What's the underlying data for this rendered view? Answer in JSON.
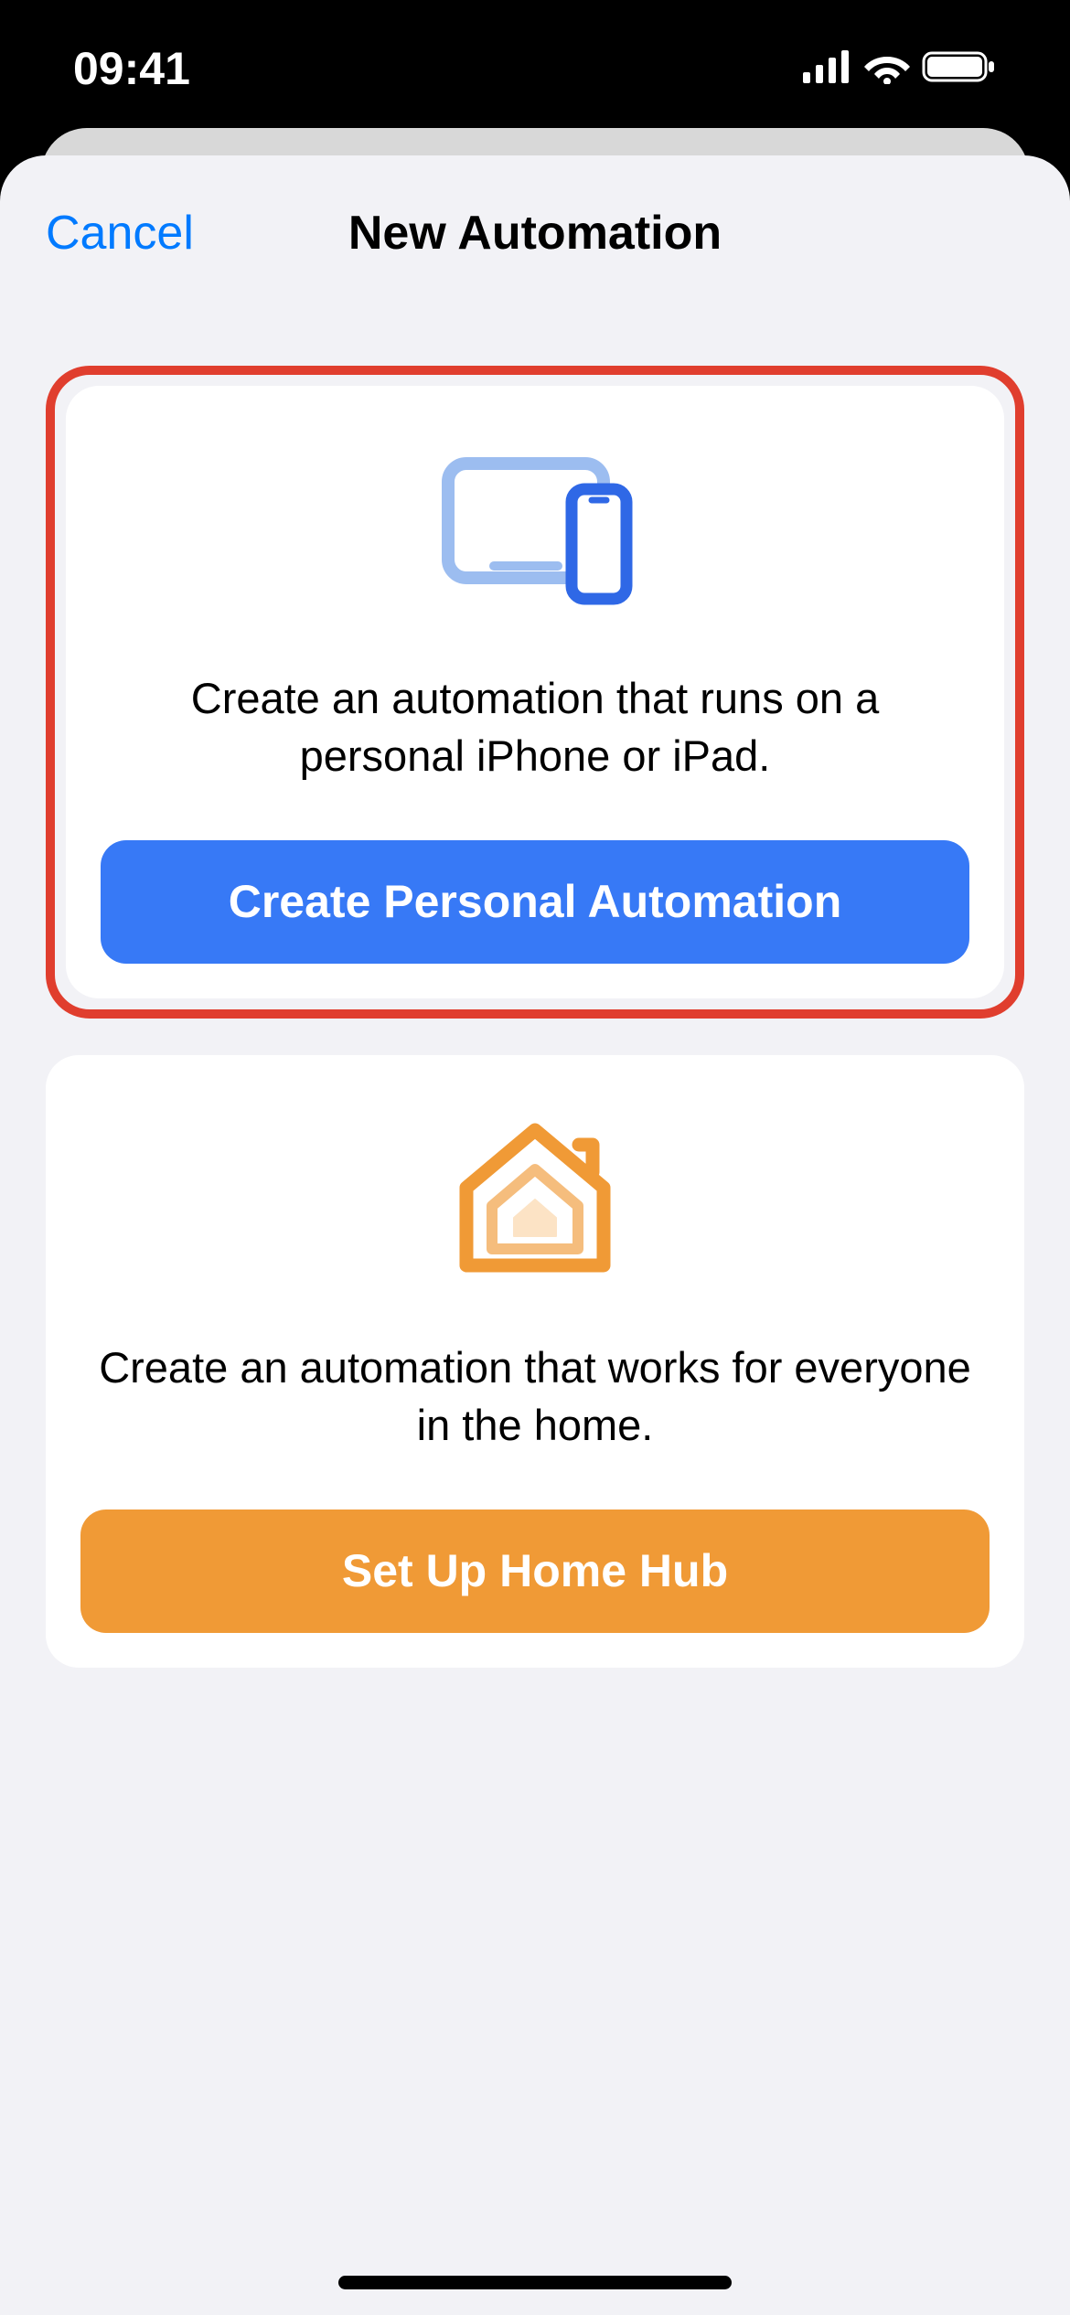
{
  "statusBar": {
    "time": "09:41"
  },
  "sheet": {
    "cancel": "Cancel",
    "title": "New Automation"
  },
  "personalCard": {
    "description": "Create an automation that runs on a personal iPhone or iPad.",
    "buttonLabel": "Create Personal Automation"
  },
  "homeCard": {
    "description": "Create an automation that works for everyone in the home.",
    "buttonLabel": "Set Up Home Hub"
  }
}
